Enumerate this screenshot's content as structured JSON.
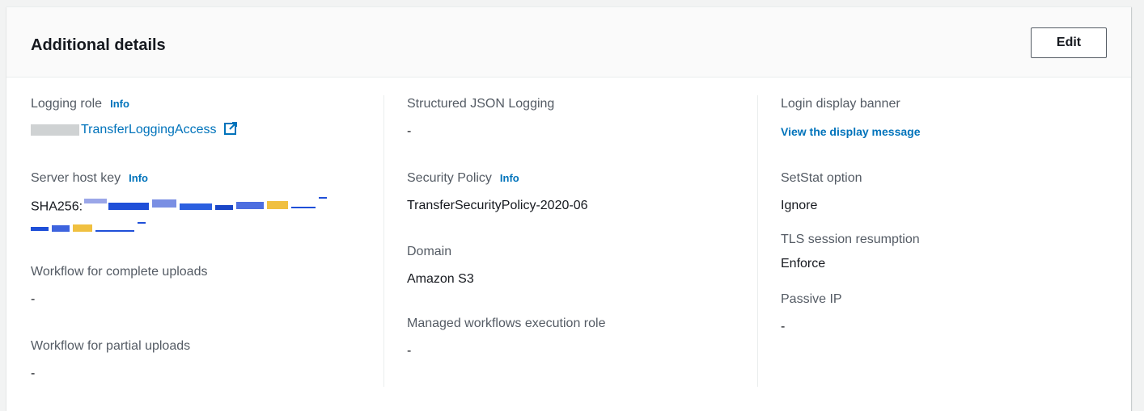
{
  "panel": {
    "title": "Additional details",
    "edit_label": "Edit"
  },
  "col1": {
    "logging_role": {
      "label": "Logging role",
      "info": "Info",
      "value": "TransferLoggingAccess"
    },
    "server_host_key": {
      "label": "Server host key",
      "info": "Info",
      "value_prefix": "SHA256:"
    },
    "workflow_complete": {
      "label": "Workflow for complete uploads",
      "value": "-"
    },
    "workflow_partial": {
      "label": "Workflow for partial uploads",
      "value": "-"
    }
  },
  "col2": {
    "structured_json": {
      "label": "Structured JSON Logging",
      "value": "-"
    },
    "security_policy": {
      "label": "Security Policy",
      "info": "Info",
      "value": "TransferSecurityPolicy-2020-06"
    },
    "domain": {
      "label": "Domain",
      "value": "Amazon S3"
    },
    "managed_workflows": {
      "label": "Managed workflows execution role",
      "value": "-"
    }
  },
  "col3": {
    "login_banner": {
      "label": "Login display banner",
      "link": "View the display message"
    },
    "setstat": {
      "label": "SetStat option",
      "value": "Ignore"
    },
    "tls": {
      "label": "TLS session resumption",
      "value": "Enforce"
    },
    "passive_ip": {
      "label": "Passive IP",
      "value": "-"
    }
  },
  "colors": {
    "link": "#0073bb",
    "label": "#545b64",
    "text": "#16191f",
    "divider": "#eaeded"
  }
}
